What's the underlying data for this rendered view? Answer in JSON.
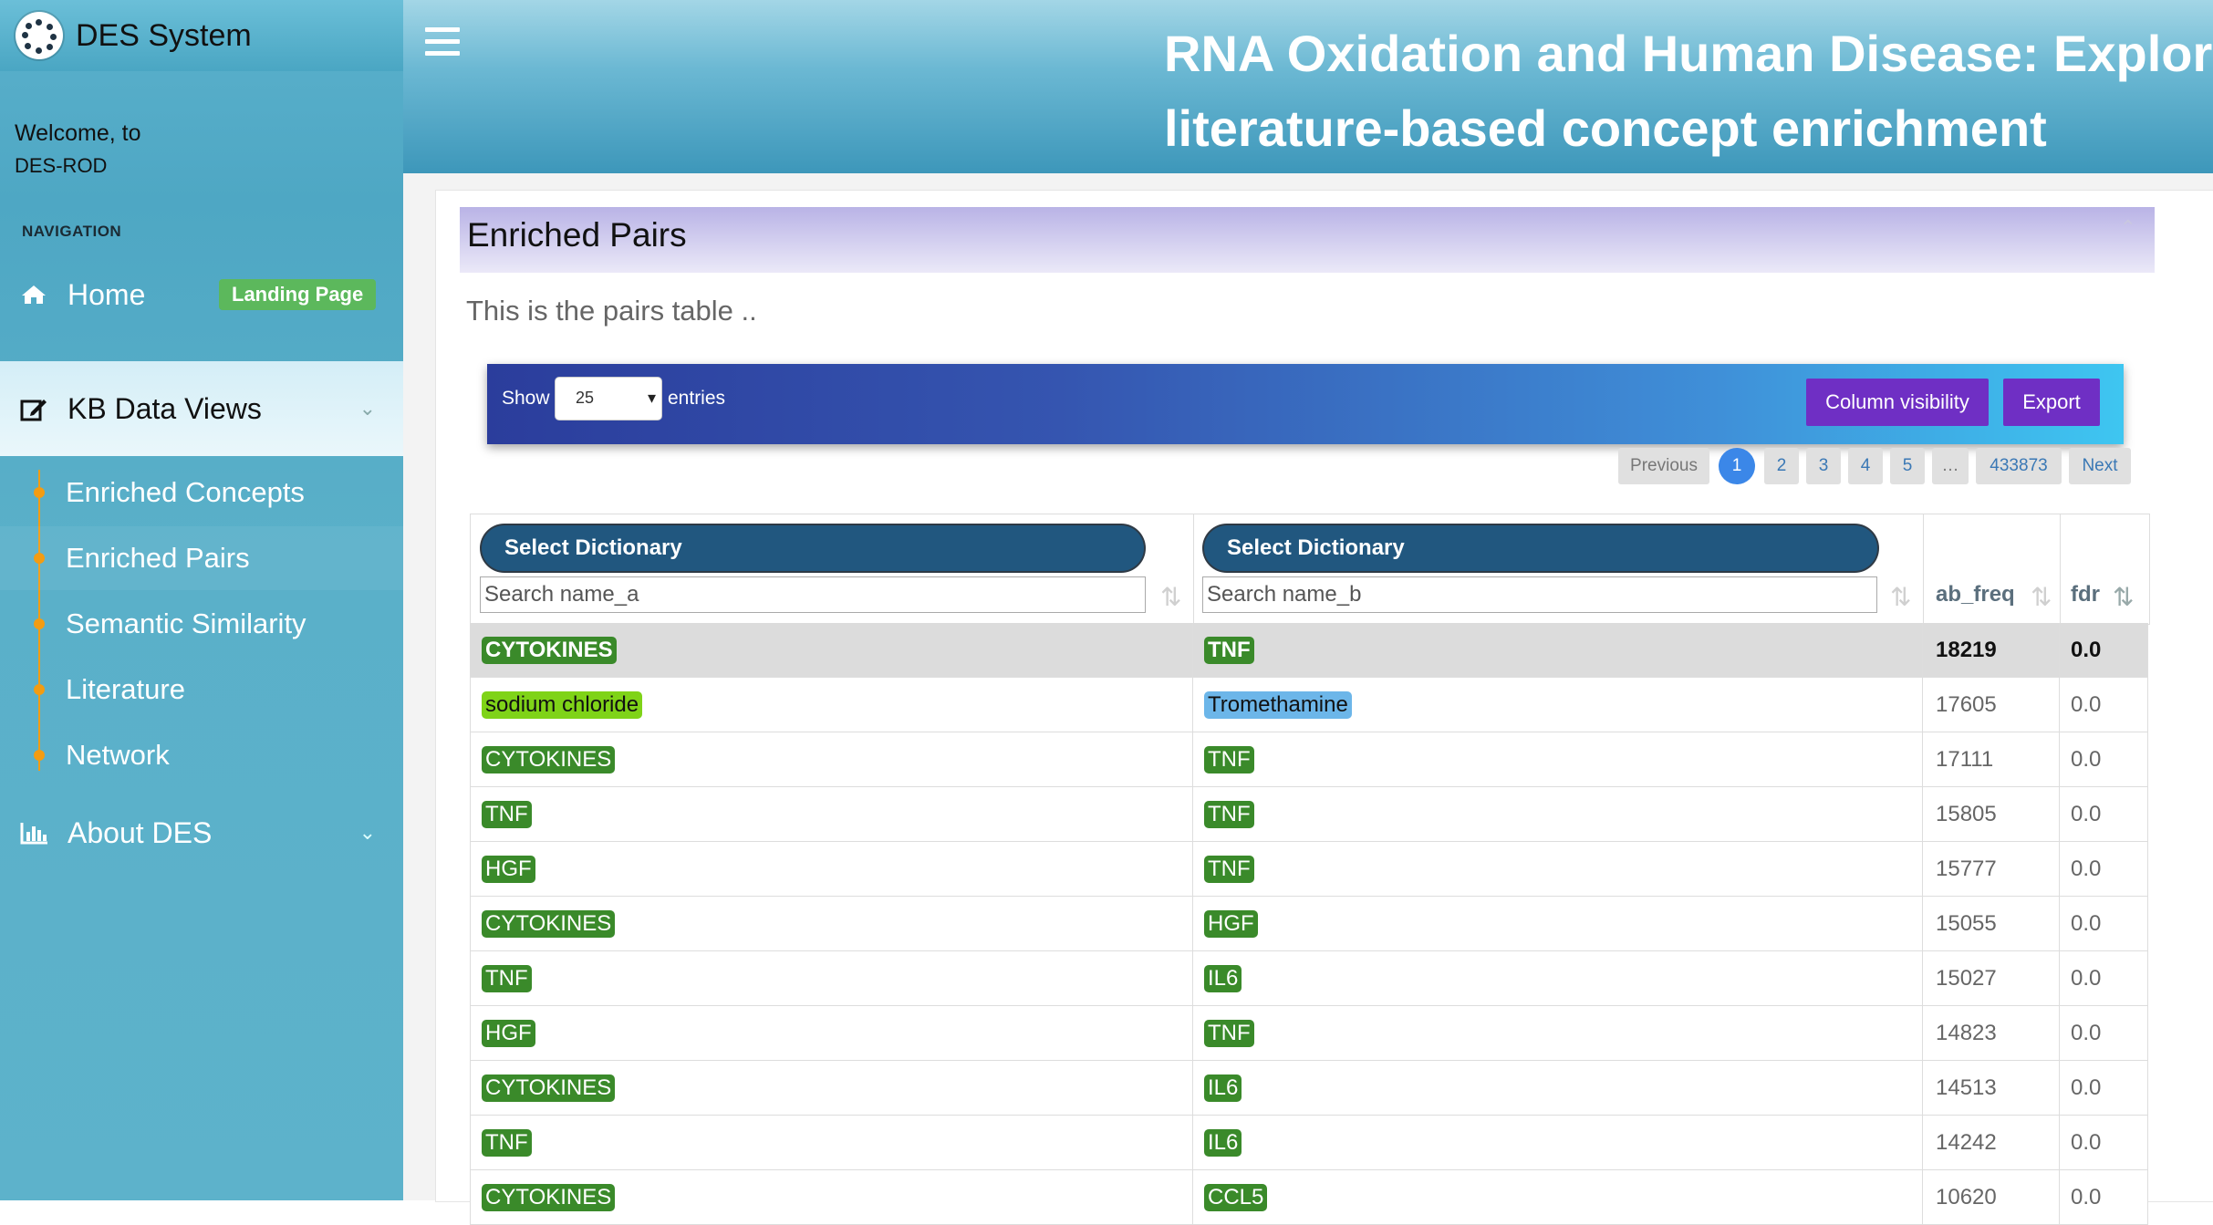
{
  "brand": {
    "name": "DES System"
  },
  "welcome": {
    "line1": "Welcome, to",
    "org": "DES-ROD"
  },
  "sidebar": {
    "nav_heading": "NAVIGATION",
    "home": {
      "label": "Home",
      "badge": "Landing Page",
      "icon": "home-icon"
    },
    "kb": {
      "label": "KB Data Views",
      "icon": "edit-icon"
    },
    "subitems": [
      "Enriched Concepts",
      "Enriched Pairs",
      "Semantic Similarity",
      "Literature",
      "Network"
    ],
    "about": {
      "label": "About DES",
      "icon": "bar-chart-icon"
    }
  },
  "header": {
    "title_line1": "RNA Oxidation and Human Disease: Explor",
    "title_line2": "literature-based concept enrichment"
  },
  "card": {
    "title": "Enriched Pairs",
    "description": "This is the pairs table .."
  },
  "toolbar": {
    "show_label": "Show",
    "length_value": "25",
    "entries_label": "entries",
    "colvis_label": "Column visibility",
    "export_label": "Export"
  },
  "pagination": {
    "previous": "Previous",
    "pages": [
      "1",
      "2",
      "3",
      "4",
      "5",
      "…",
      "433873"
    ],
    "next": "Next",
    "current": "1"
  },
  "table": {
    "dict_select_a": "Select Dictionary",
    "dict_select_b": "Select Dictionary",
    "search_a_placeholder": "Search name_a",
    "search_b_placeholder": "Search name_b",
    "col_freq": "ab_freq",
    "col_fdr": "fdr",
    "rows": [
      {
        "a": "CYTOKINES",
        "b": "TNF",
        "freq": "18219",
        "fdr": "0.0"
      },
      {
        "a": "sodium chloride",
        "b": "Tromethamine",
        "freq": "17605",
        "fdr": "0.0"
      },
      {
        "a": "CYTOKINES",
        "b": "TNF",
        "freq": "17111",
        "fdr": "0.0"
      },
      {
        "a": "TNF",
        "b": "TNF",
        "freq": "15805",
        "fdr": "0.0"
      },
      {
        "a": "HGF",
        "b": "TNF",
        "freq": "15777",
        "fdr": "0.0"
      },
      {
        "a": "CYTOKINES",
        "b": "HGF",
        "freq": "15055",
        "fdr": "0.0"
      },
      {
        "a": "TNF",
        "b": "IL6",
        "freq": "15027",
        "fdr": "0.0"
      },
      {
        "a": "HGF",
        "b": "TNF",
        "freq": "14823",
        "fdr": "0.0"
      },
      {
        "a": "CYTOKINES",
        "b": "IL6",
        "freq": "14513",
        "fdr": "0.0"
      },
      {
        "a": "TNF",
        "b": "IL6",
        "freq": "14242",
        "fdr": "0.0"
      },
      {
        "a": "CYTOKINES",
        "b": "CCL5",
        "freq": "10620",
        "fdr": "0.0"
      }
    ]
  },
  "colors": {
    "tag_green": "#3a8a2a",
    "tag_lime": "#7fd318",
    "tag_blue": "#6cb6e9",
    "button_purple": "#6f2fc4",
    "dict_select": "#21577f",
    "page_active": "#3b87e8"
  }
}
